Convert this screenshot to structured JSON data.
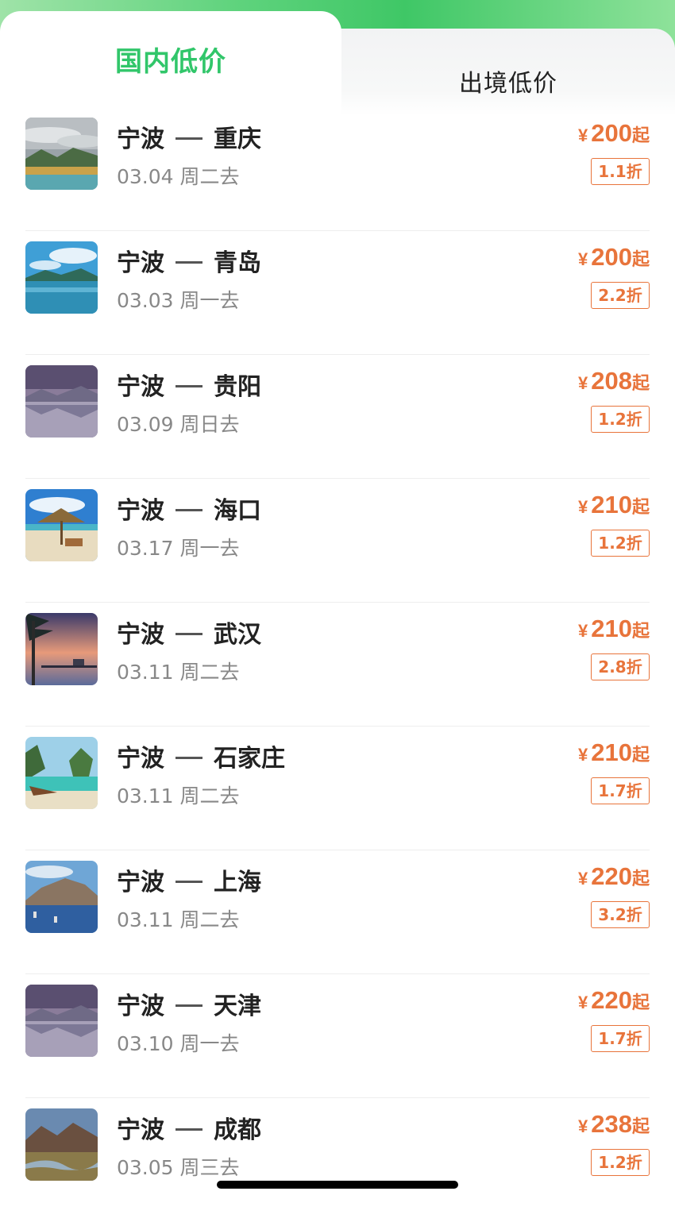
{
  "tabs": {
    "domestic_label": "国内低价",
    "international_label": "出境低价"
  },
  "routes": [
    {
      "origin": "宁波",
      "destination": "重庆",
      "date": "03.04 周二去",
      "currency": "¥",
      "price": "200",
      "suffix": "起",
      "discount": "1.1折"
    },
    {
      "origin": "宁波",
      "destination": "青岛",
      "date": "03.03 周一去",
      "currency": "¥",
      "price": "200",
      "suffix": "起",
      "discount": "2.2折"
    },
    {
      "origin": "宁波",
      "destination": "贵阳",
      "date": "03.09 周日去",
      "currency": "¥",
      "price": "208",
      "suffix": "起",
      "discount": "1.2折"
    },
    {
      "origin": "宁波",
      "destination": "海口",
      "date": "03.17 周一去",
      "currency": "¥",
      "price": "210",
      "suffix": "起",
      "discount": "1.2折"
    },
    {
      "origin": "宁波",
      "destination": "武汉",
      "date": "03.11 周二去",
      "currency": "¥",
      "price": "210",
      "suffix": "起",
      "discount": "2.8折"
    },
    {
      "origin": "宁波",
      "destination": "石家庄",
      "date": "03.11 周二去",
      "currency": "¥",
      "price": "210",
      "suffix": "起",
      "discount": "1.7折"
    },
    {
      "origin": "宁波",
      "destination": "上海",
      "date": "03.11 周二去",
      "currency": "¥",
      "price": "220",
      "suffix": "起",
      "discount": "3.2折"
    },
    {
      "origin": "宁波",
      "destination": "天津",
      "date": "03.10 周一去",
      "currency": "¥",
      "price": "220",
      "suffix": "起",
      "discount": "1.7折"
    },
    {
      "origin": "宁波",
      "destination": "成都",
      "date": "03.05 周三去",
      "currency": "¥",
      "price": "238",
      "suffix": "起",
      "discount": "1.2折"
    }
  ],
  "colors": {
    "accent_green": "#31c66a",
    "price_orange": "#e8743b"
  }
}
